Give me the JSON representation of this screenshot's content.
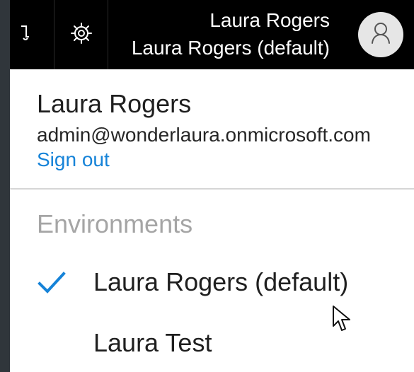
{
  "header": {
    "account_name": "Laura Rogers",
    "environment_name": "Laura Rogers (default)",
    "icons": {
      "notification": "notification-icon",
      "settings": "gear-icon",
      "avatar": "person-icon"
    }
  },
  "account_panel": {
    "user_name": "Laura Rogers",
    "email": "admin@wonderlaura.onmicrosoft.com",
    "sign_out_label": "Sign out"
  },
  "environments": {
    "heading": "Environments",
    "items": [
      {
        "label": "Laura Rogers (default)",
        "selected": true
      },
      {
        "label": "Laura Test",
        "selected": false
      }
    ]
  },
  "colors": {
    "topbar": "#000000",
    "panel": "#ffffff",
    "link": "#1683d8",
    "muted_heading": "#a5a5a5",
    "checkmark": "#1683d8"
  }
}
